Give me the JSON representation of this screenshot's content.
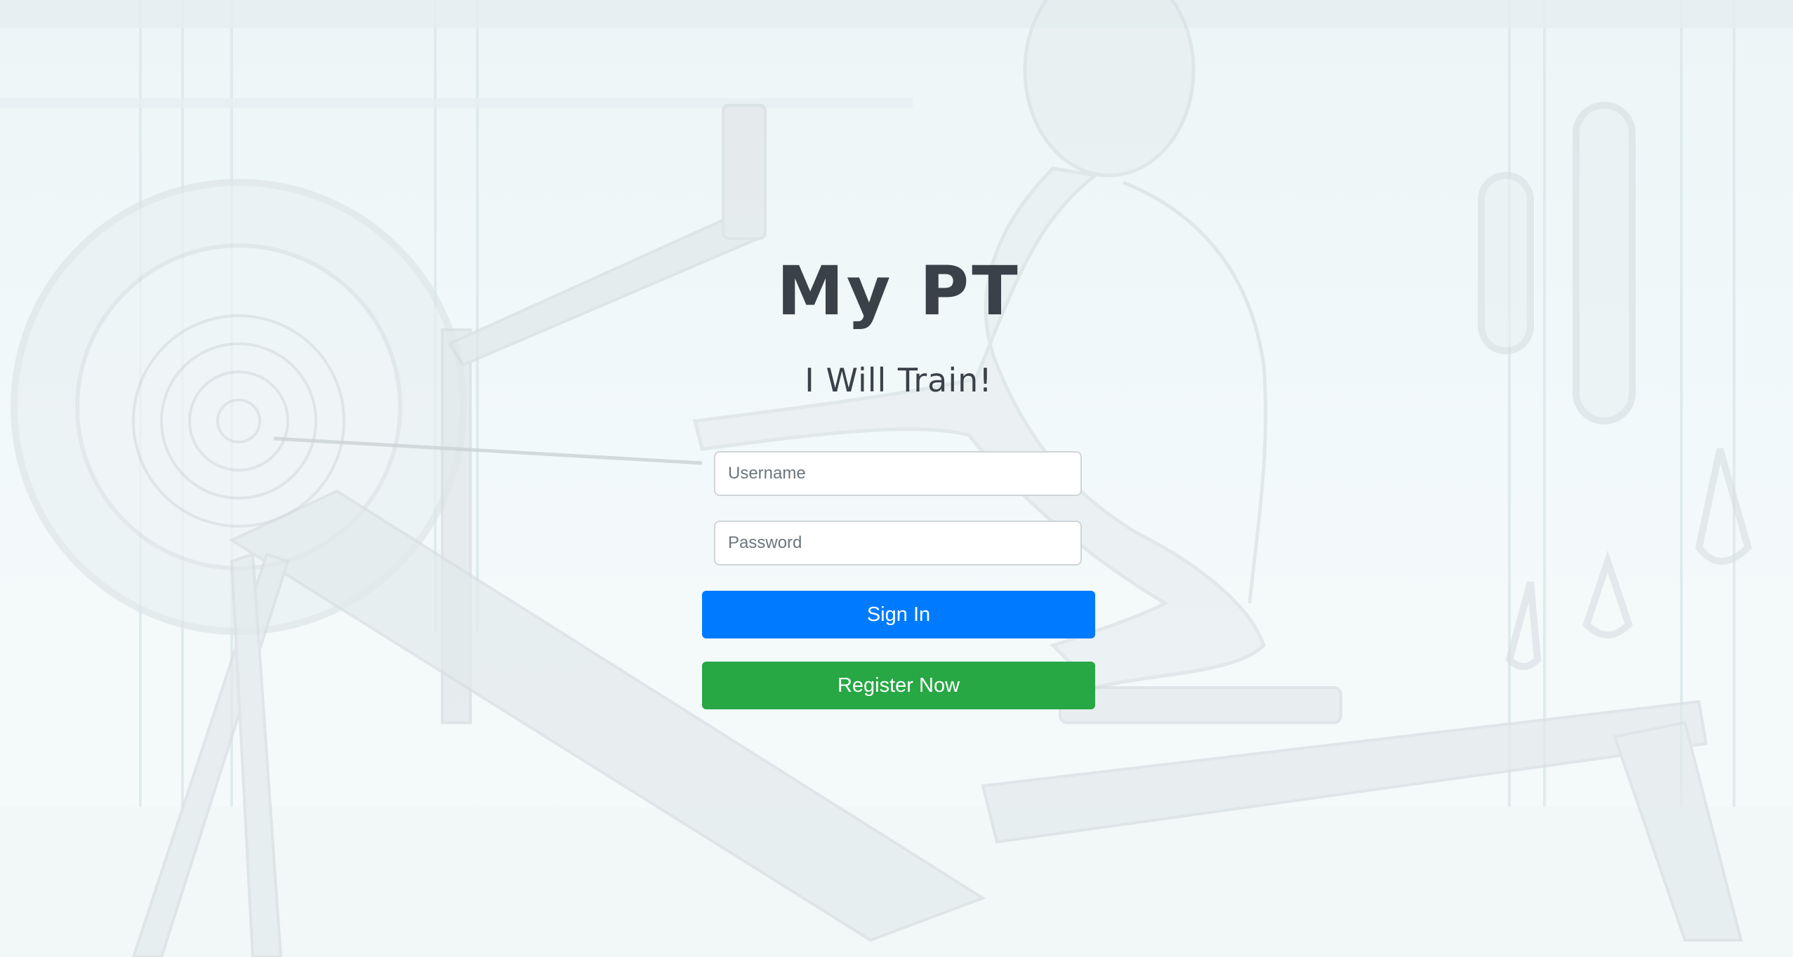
{
  "app": {
    "title": "My PT",
    "subtitle": "I Will Train!"
  },
  "login_form": {
    "username_placeholder": "Username",
    "password_placeholder": "Password",
    "sign_in_label": "Sign In",
    "register_label": "Register Now"
  },
  "colors": {
    "primary_button": "#007bff",
    "register_button": "#28a745",
    "title_text": "#3a4149"
  }
}
